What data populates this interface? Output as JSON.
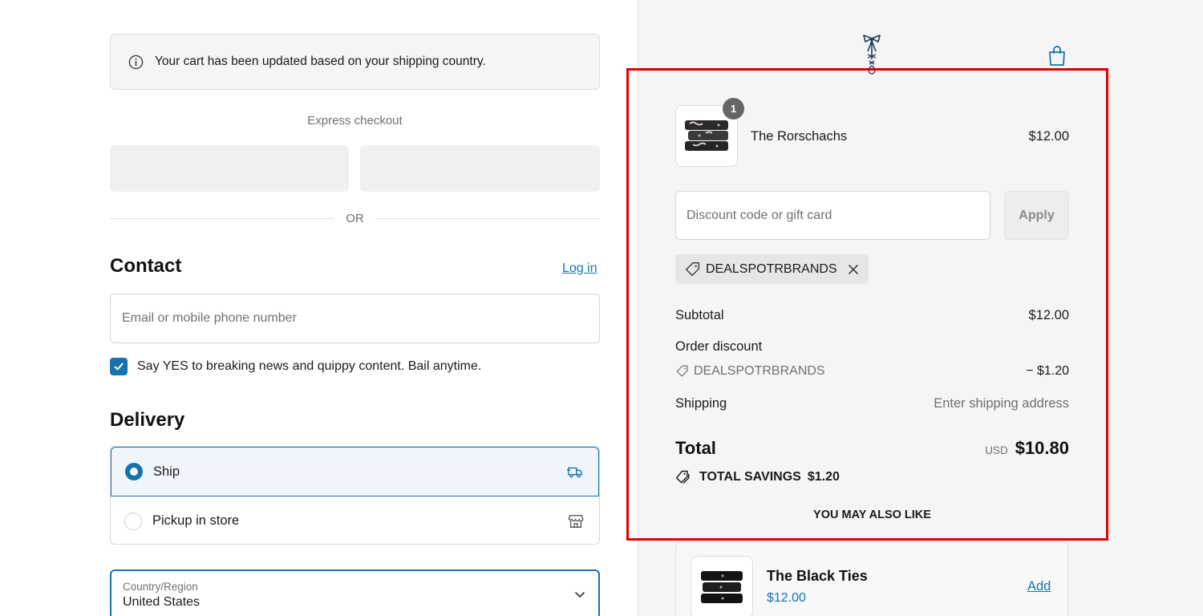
{
  "notice": {
    "text": "Your cart has been updated based on your shipping country.",
    "icon": "info-icon"
  },
  "express": {
    "title": "Express checkout",
    "divider": "OR"
  },
  "contact": {
    "heading": "Contact",
    "login_link": "Log in",
    "email_placeholder": "Email or mobile phone number",
    "newsletter_label": "Say YES to breaking news and quippy content. Bail anytime.",
    "newsletter_checked": true
  },
  "delivery": {
    "heading": "Delivery",
    "options": [
      {
        "label": "Ship",
        "selected": true,
        "icon": "truck-icon"
      },
      {
        "label": "Pickup in store",
        "selected": false,
        "icon": "store-icon"
      }
    ],
    "country_label": "Country/Region",
    "country_value": "United States"
  },
  "order": {
    "item": {
      "name": "The Rorschachs",
      "price": "$12.00",
      "quantity": "1"
    },
    "discount_placeholder": "Discount code or gift card",
    "apply_label": "Apply",
    "applied_code": "DEALSPOTRBRANDS",
    "subtotal_label": "Subtotal",
    "subtotal_value": "$12.00",
    "order_discount_label": "Order discount",
    "discount_code": "DEALSPOTRBRANDS",
    "discount_value": "− $1.20",
    "shipping_label": "Shipping",
    "shipping_value": "Enter shipping address",
    "total_label": "Total",
    "total_currency": "USD",
    "total_value": "$10.80",
    "savings_label": "TOTAL SAVINGS",
    "savings_value": "$1.20",
    "also_like": "YOU MAY ALSO LIKE"
  },
  "recommendation": {
    "name": "The Black Ties",
    "price": "$12.00",
    "add_label": "Add"
  },
  "colors": {
    "accent": "#1773b0",
    "highlight": "#e00000",
    "sidebar_bg": "#f5f5f5"
  }
}
